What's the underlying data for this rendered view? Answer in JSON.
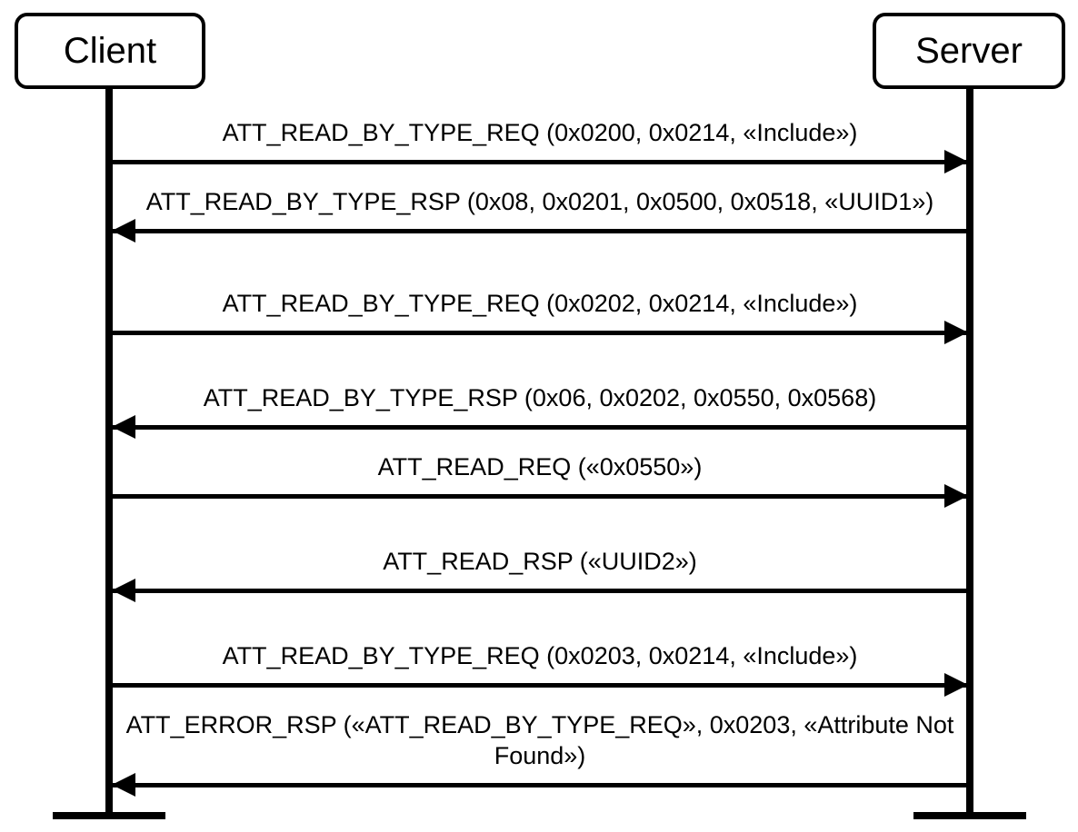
{
  "actors": {
    "client": "Client",
    "server": "Server"
  },
  "messages": {
    "m1": {
      "dir": "right",
      "text": "ATT_READ_BY_TYPE_REQ (0x0200, 0x0214, «Include»)"
    },
    "m2": {
      "dir": "left",
      "text": "ATT_READ_BY_TYPE_RSP (0x08, 0x0201, 0x0500, 0x0518, «UUID1»)"
    },
    "m3": {
      "dir": "right",
      "text": "ATT_READ_BY_TYPE_REQ (0x0202, 0x0214, «Include»)"
    },
    "m4": {
      "dir": "left",
      "text": "ATT_READ_BY_TYPE_RSP (0x06, 0x0202, 0x0550, 0x0568)"
    },
    "m5": {
      "dir": "right",
      "text": "ATT_READ_REQ («0x0550»)"
    },
    "m6": {
      "dir": "left",
      "text": "ATT_READ_RSP («UUID2»)"
    },
    "m7": {
      "dir": "right",
      "text": "ATT_READ_BY_TYPE_REQ (0x0203, 0x0214, «Include»)"
    },
    "m8": {
      "dir": "left",
      "text": "ATT_ERROR_RSP («ATT_READ_BY_TYPE_REQ», 0x0203, «Attribute Not Found»)"
    }
  }
}
